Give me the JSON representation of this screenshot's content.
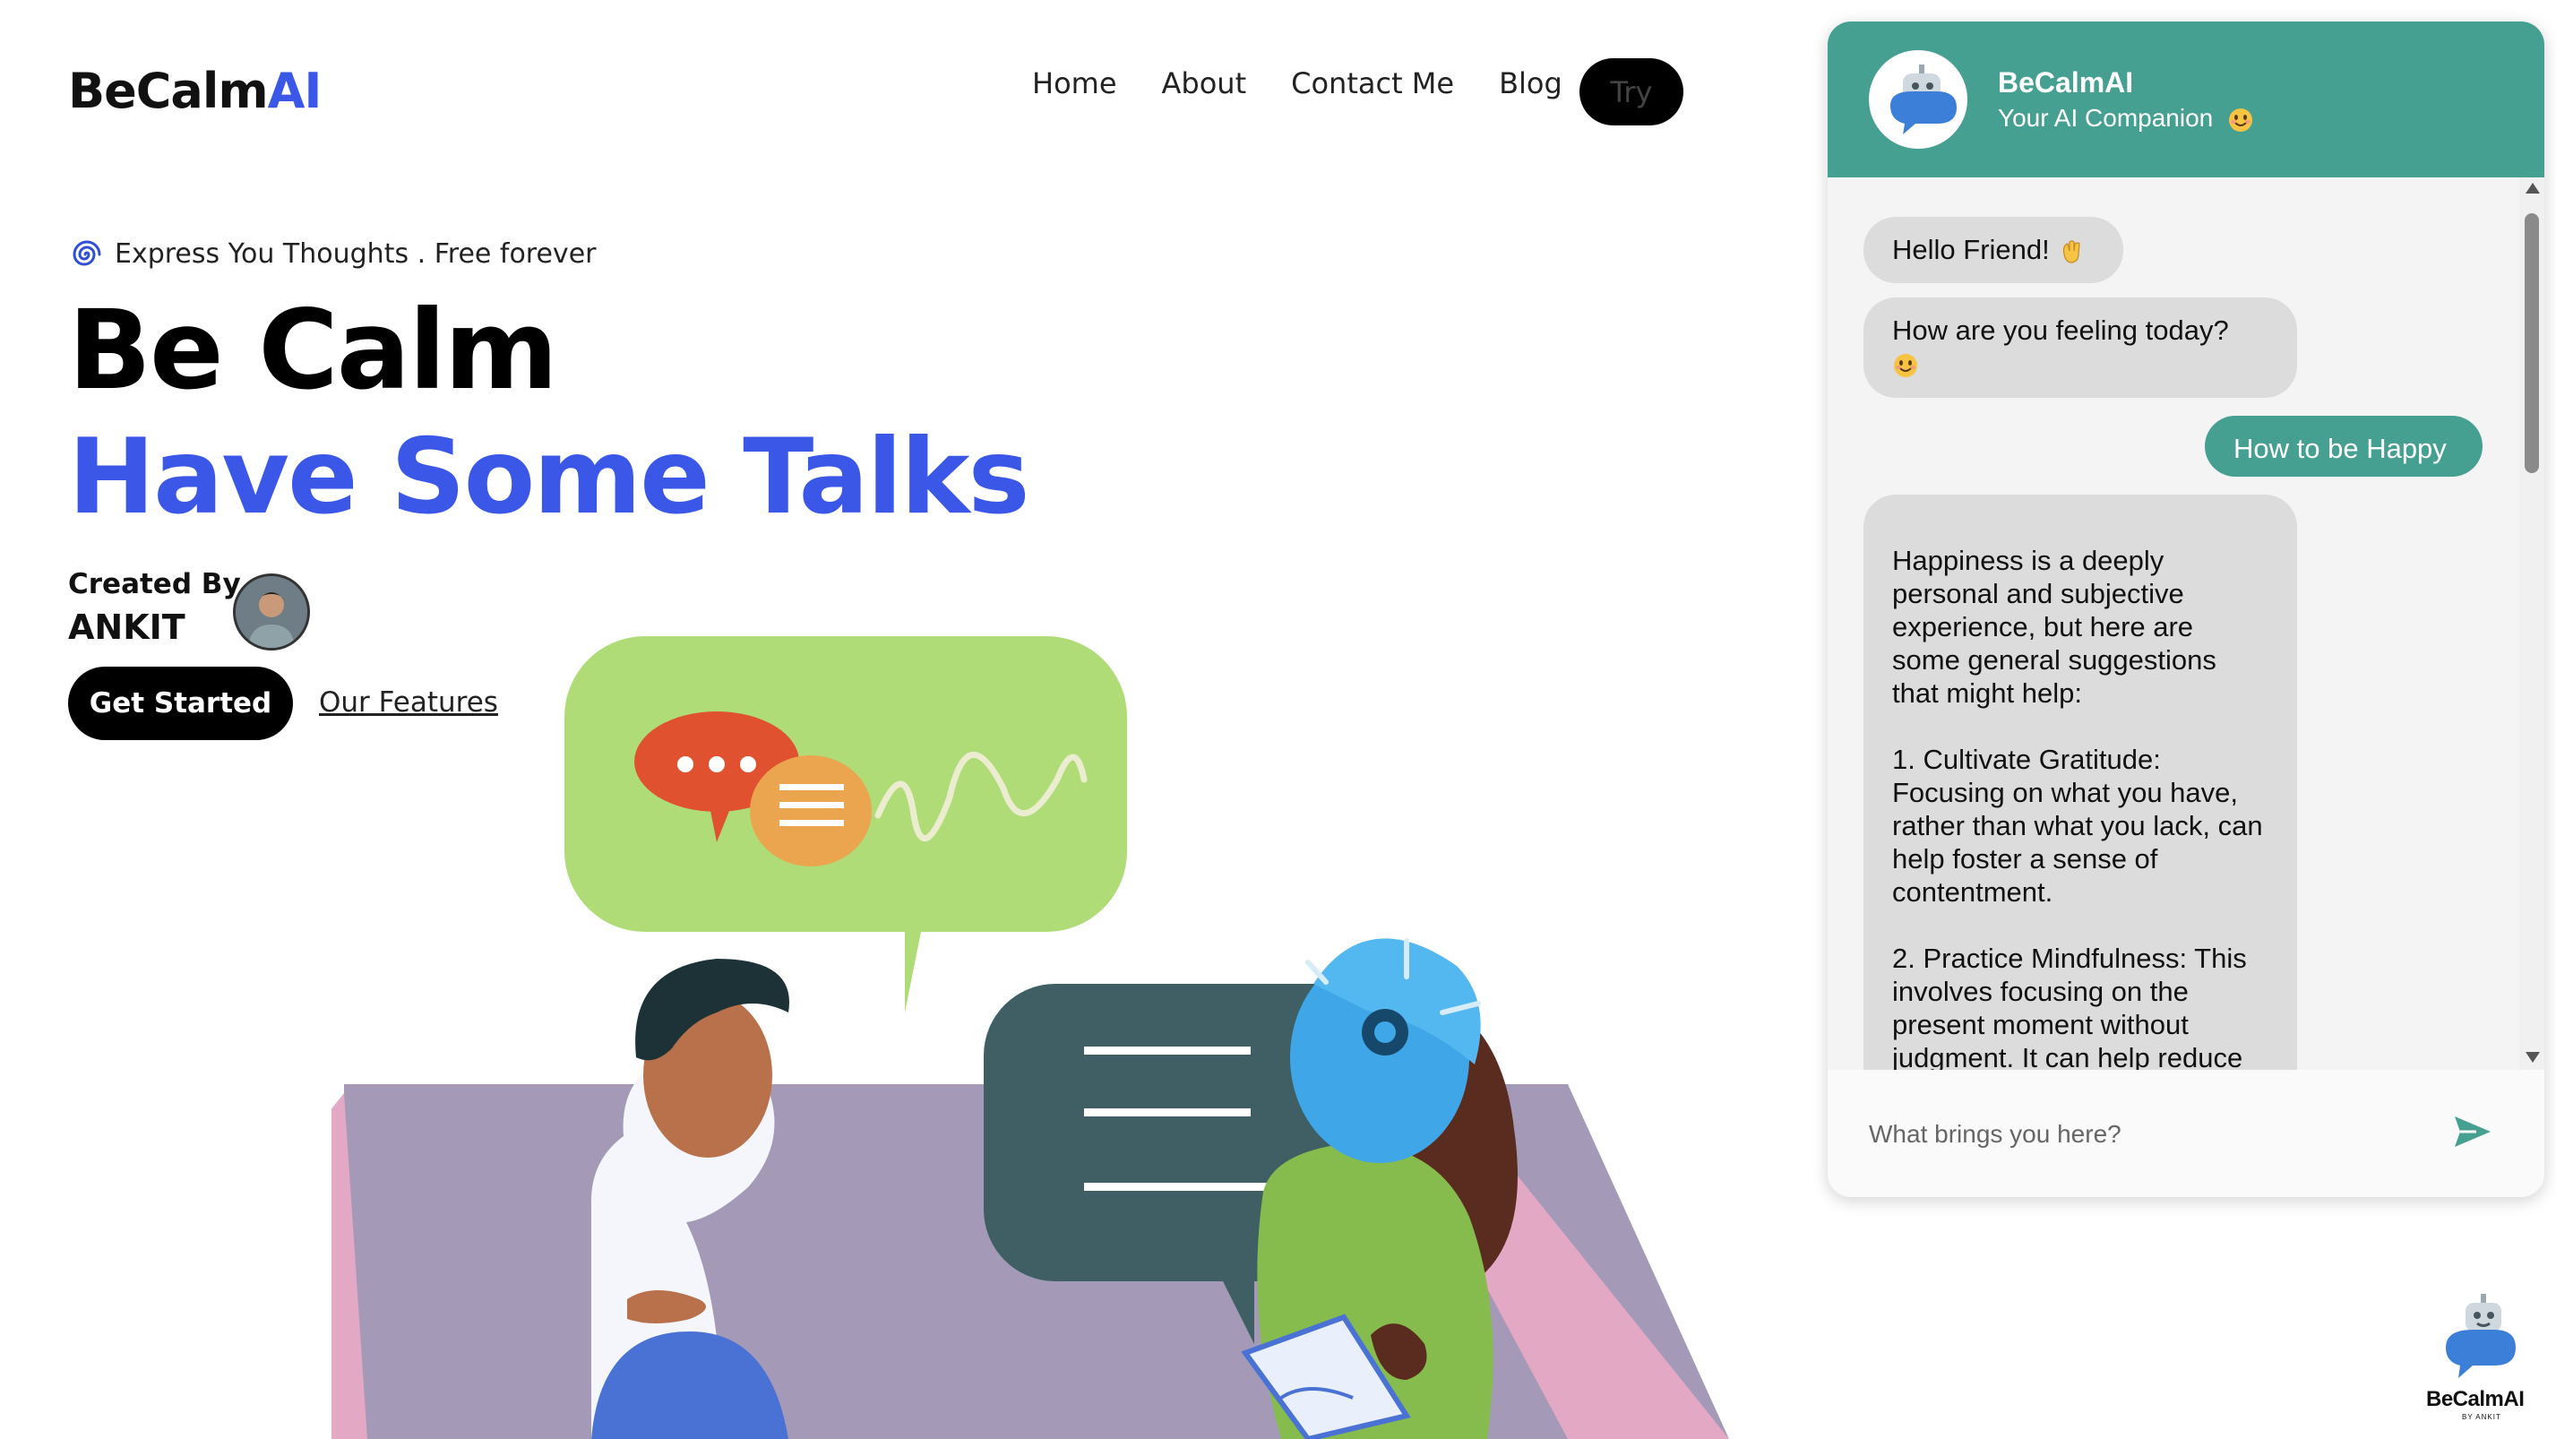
{
  "brand": {
    "name_part1": "BeCalm",
    "name_part2": "AI",
    "accent_color": "#3a57e8"
  },
  "nav": {
    "items": [
      {
        "label": "Home"
      },
      {
        "label": "About"
      },
      {
        "label": "Contact Me"
      },
      {
        "label": "Blog"
      }
    ],
    "try_label": "Try"
  },
  "hero": {
    "tagline_icon": "spiral-icon",
    "tagline": "Express You Thoughts . Free forever",
    "headline_line1": "Be Calm",
    "headline_line2": "Have Some Talks",
    "created_by_label": "Created By",
    "creator_name": "ANKIT",
    "get_started_label": "Get Started",
    "features_link_label": "Our Features"
  },
  "chat": {
    "header_color": "#46a092",
    "title": "BeCalmAI",
    "subtitle": "Your AI Companion",
    "messages": [
      {
        "role": "bot",
        "text": "Hello Friend!",
        "emoji": "waving-hand-icon"
      },
      {
        "role": "bot",
        "text": "How are you feeling today?",
        "emoji": "smiling-face-icon"
      },
      {
        "role": "user",
        "text": "How to be Happy"
      },
      {
        "role": "bot",
        "text": "Happiness is a deeply personal and subjective experience, but here are some general suggestions that might help:\n\n1. Cultivate Gratitude: Focusing on what you have, rather than what you lack, can help foster a sense of contentment.\n\n2. Practice Mindfulness: This involves focusing on the present moment without judgment. It can help reduce stress and increase overall well-being"
      }
    ],
    "input_placeholder": "What brings you here?",
    "send_icon": "send-icon"
  },
  "floating_badge": {
    "label": "BeCalmAI",
    "sub_label": "BY ANKIT"
  }
}
